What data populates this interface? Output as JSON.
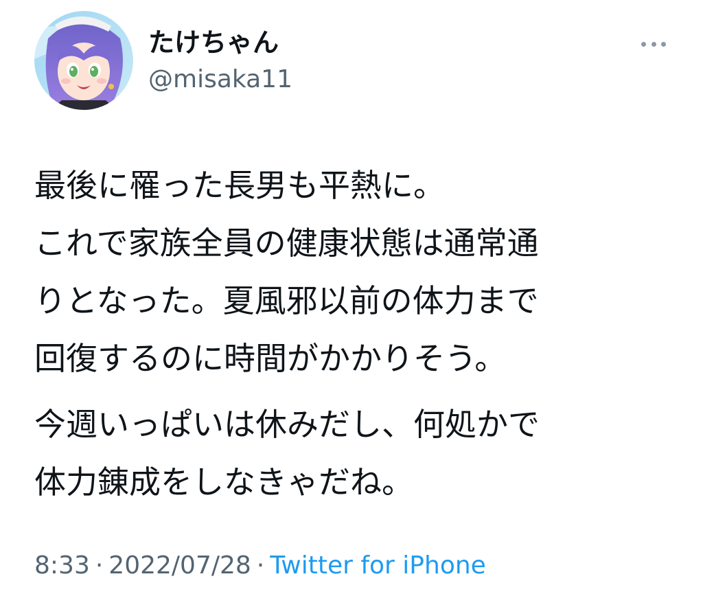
{
  "user": {
    "display_name": "たけちゃん",
    "handle": "@misaka11",
    "avatar_icon": "avatar-icon"
  },
  "more_icon": "more-horizontal-icon",
  "tweet": {
    "paragraphs": [
      {
        "lines": [
          "最後に罹った長男も平熱に。",
          "これで家族全員の健康状態は通常通",
          "りとなった。夏風邪以前の体力まで",
          "回復するのに時間がかかりそう。"
        ]
      },
      {
        "lines": [
          "今週いっぱいは休みだし、何処かで",
          "体力錬成をしなきゃだね。"
        ]
      }
    ]
  },
  "meta": {
    "time": "8:33",
    "separator": "·",
    "date": "2022/07/28",
    "source": "Twitter for iPhone"
  },
  "colors": {
    "text": "#0f1419",
    "secondary": "#536471",
    "link": "#1d9bf0"
  }
}
